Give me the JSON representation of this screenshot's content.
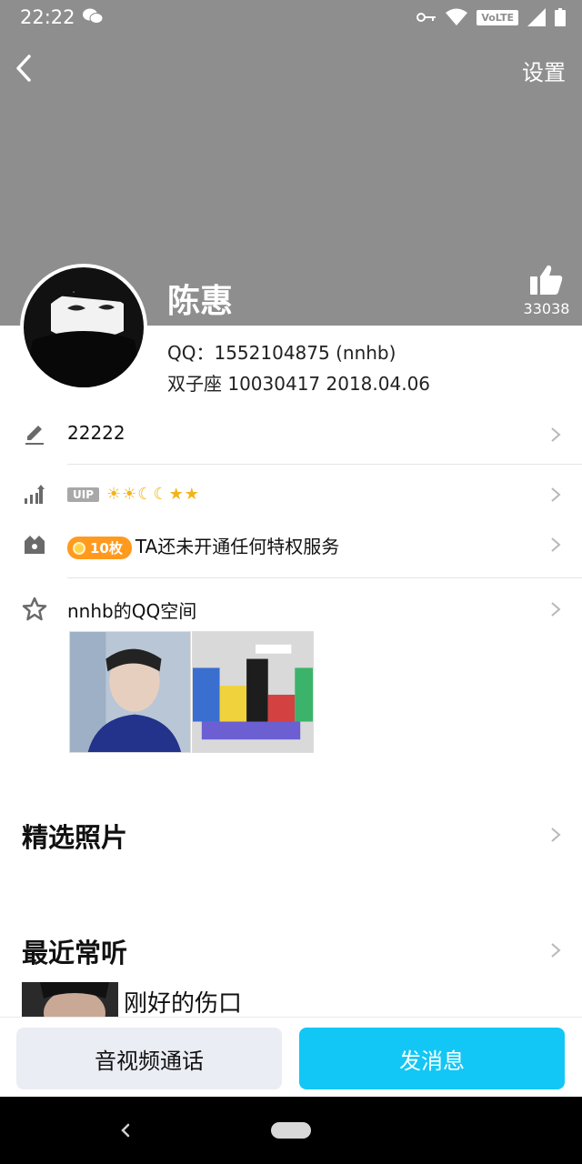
{
  "status_bar": {
    "time": "22:22",
    "network": "VoLTE"
  },
  "header": {
    "back_icon": "back-arrow-icon",
    "settings_label": "设置"
  },
  "profile": {
    "name": "陈惠",
    "like_count": "33038",
    "qq_line": "QQ：1552104875 (nnhb)",
    "info_line": "双子座  10030417  2018.04.06"
  },
  "rows": {
    "signature": "22222",
    "vip_badge": "UIP",
    "vip_level_icons": "☀☀☾☾★★",
    "coin_count": "10枚",
    "privilege": "TA还未开通任何特权服务",
    "qzone": "nnhb的QQ空间"
  },
  "sections": {
    "photos_title": "精选照片",
    "music_title": "最近常听",
    "song_title": "刚好的伤口"
  },
  "actions": {
    "call_label": "音视频通话",
    "message_label": "发消息"
  },
  "colors": {
    "header_bg": "#8e8e8e",
    "accent": "#12c7f5",
    "coin": "#ff9a1f"
  }
}
